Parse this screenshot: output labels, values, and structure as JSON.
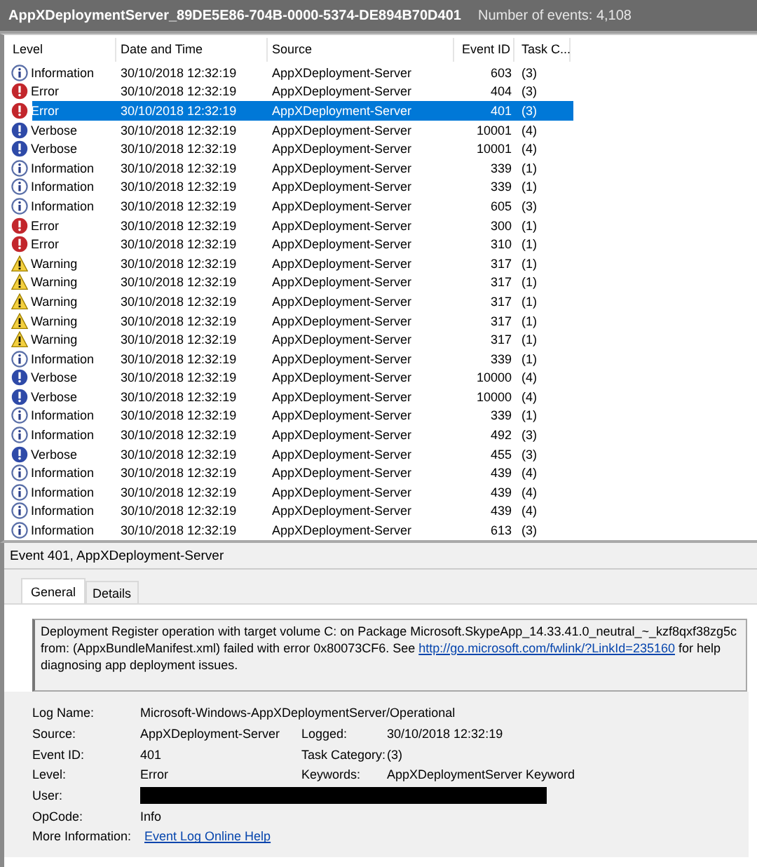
{
  "window": {
    "title": "AppXDeploymentServer_89DE5E86-704B-0000-5374-DE894B70D401",
    "event_count": "Number of events: 4,108"
  },
  "table": {
    "columns": [
      "Level",
      "Date and Time",
      "Source",
      "Event ID",
      "Task C..."
    ],
    "rows": [
      {
        "level": "Information",
        "kind": "info",
        "date": "30/10/2018 12:32:19",
        "source": "AppXDeployment-Server",
        "event_id": "603",
        "task": "(3)",
        "selected": false
      },
      {
        "level": "Error",
        "kind": "error",
        "date": "30/10/2018 12:32:19",
        "source": "AppXDeployment-Server",
        "event_id": "404",
        "task": "(3)",
        "selected": false
      },
      {
        "level": "Error",
        "kind": "error",
        "date": "30/10/2018 12:32:19",
        "source": "AppXDeployment-Server",
        "event_id": "401",
        "task": "(3)",
        "selected": true
      },
      {
        "level": "Verbose",
        "kind": "verbose",
        "date": "30/10/2018 12:32:19",
        "source": "AppXDeployment-Server",
        "event_id": "10001",
        "task": "(4)",
        "selected": false
      },
      {
        "level": "Verbose",
        "kind": "verbose",
        "date": "30/10/2018 12:32:19",
        "source": "AppXDeployment-Server",
        "event_id": "10001",
        "task": "(4)",
        "selected": false
      },
      {
        "level": "Information",
        "kind": "info",
        "date": "30/10/2018 12:32:19",
        "source": "AppXDeployment-Server",
        "event_id": "339",
        "task": "(1)",
        "selected": false
      },
      {
        "level": "Information",
        "kind": "info",
        "date": "30/10/2018 12:32:19",
        "source": "AppXDeployment-Server",
        "event_id": "339",
        "task": "(1)",
        "selected": false
      },
      {
        "level": "Information",
        "kind": "info",
        "date": "30/10/2018 12:32:19",
        "source": "AppXDeployment-Server",
        "event_id": "605",
        "task": "(3)",
        "selected": false
      },
      {
        "level": "Error",
        "kind": "error",
        "date": "30/10/2018 12:32:19",
        "source": "AppXDeployment-Server",
        "event_id": "300",
        "task": "(1)",
        "selected": false
      },
      {
        "level": "Error",
        "kind": "error",
        "date": "30/10/2018 12:32:19",
        "source": "AppXDeployment-Server",
        "event_id": "310",
        "task": "(1)",
        "selected": false
      },
      {
        "level": "Warning",
        "kind": "warning",
        "date": "30/10/2018 12:32:19",
        "source": "AppXDeployment-Server",
        "event_id": "317",
        "task": "(1)",
        "selected": false
      },
      {
        "level": "Warning",
        "kind": "warning",
        "date": "30/10/2018 12:32:19",
        "source": "AppXDeployment-Server",
        "event_id": "317",
        "task": "(1)",
        "selected": false
      },
      {
        "level": "Warning",
        "kind": "warning",
        "date": "30/10/2018 12:32:19",
        "source": "AppXDeployment-Server",
        "event_id": "317",
        "task": "(1)",
        "selected": false
      },
      {
        "level": "Warning",
        "kind": "warning",
        "date": "30/10/2018 12:32:19",
        "source": "AppXDeployment-Server",
        "event_id": "317",
        "task": "(1)",
        "selected": false
      },
      {
        "level": "Warning",
        "kind": "warning",
        "date": "30/10/2018 12:32:19",
        "source": "AppXDeployment-Server",
        "event_id": "317",
        "task": "(1)",
        "selected": false
      },
      {
        "level": "Information",
        "kind": "info",
        "date": "30/10/2018 12:32:19",
        "source": "AppXDeployment-Server",
        "event_id": "339",
        "task": "(1)",
        "selected": false
      },
      {
        "level": "Verbose",
        "kind": "verbose",
        "date": "30/10/2018 12:32:19",
        "source": "AppXDeployment-Server",
        "event_id": "10000",
        "task": "(4)",
        "selected": false
      },
      {
        "level": "Verbose",
        "kind": "verbose",
        "date": "30/10/2018 12:32:19",
        "source": "AppXDeployment-Server",
        "event_id": "10000",
        "task": "(4)",
        "selected": false
      },
      {
        "level": "Information",
        "kind": "info",
        "date": "30/10/2018 12:32:19",
        "source": "AppXDeployment-Server",
        "event_id": "339",
        "task": "(1)",
        "selected": false
      },
      {
        "level": "Information",
        "kind": "info",
        "date": "30/10/2018 12:32:19",
        "source": "AppXDeployment-Server",
        "event_id": "492",
        "task": "(3)",
        "selected": false
      },
      {
        "level": "Verbose",
        "kind": "verbose",
        "date": "30/10/2018 12:32:19",
        "source": "AppXDeployment-Server",
        "event_id": "455",
        "task": "(3)",
        "selected": false
      },
      {
        "level": "Information",
        "kind": "info",
        "date": "30/10/2018 12:32:19",
        "source": "AppXDeployment-Server",
        "event_id": "439",
        "task": "(4)",
        "selected": false
      },
      {
        "level": "Information",
        "kind": "info",
        "date": "30/10/2018 12:32:19",
        "source": "AppXDeployment-Server",
        "event_id": "439",
        "task": "(4)",
        "selected": false
      },
      {
        "level": "Information",
        "kind": "info",
        "date": "30/10/2018 12:32:19",
        "source": "AppXDeployment-Server",
        "event_id": "439",
        "task": "(4)",
        "selected": false
      },
      {
        "level": "Information",
        "kind": "info",
        "date": "30/10/2018 12:32:19",
        "source": "AppXDeployment-Server",
        "event_id": "613",
        "task": "(3)",
        "selected": false
      }
    ]
  },
  "details": {
    "title": "Event 401, AppXDeployment-Server",
    "tabs": [
      {
        "label": "General",
        "selected": true
      },
      {
        "label": "Details",
        "selected": false
      }
    ],
    "message": {
      "before": "Deployment Register operation with target volume C: on Package Microsoft.SkypeApp_14.33.41.0_neutral_~_kzf8qxf38zg5c from: (AppxBundleManifest.xml)  failed with error 0x80073CF6. See",
      "link": "http://go.microsoft.com/fwlink/?LinkId=235160",
      "after": "for help diagnosing app deployment issues."
    },
    "fields": [
      {
        "label": "Log Name:",
        "value": "Microsoft-Windows-AppXDeploymentServer/Operational",
        "kind": "text"
      },
      {
        "label": "Source:",
        "value": "AppXDeployment-Server",
        "kind": "text",
        "label2": "Logged:",
        "value2": "30/10/2018 12:32:19"
      },
      {
        "label": "Event ID:",
        "value": "401",
        "kind": "text",
        "label2": "Task Category:",
        "value2": "(3)"
      },
      {
        "label": "Level:",
        "value": "Error",
        "kind": "text",
        "label2": "Keywords:",
        "value2": "AppXDeploymentServer Keyword"
      },
      {
        "label": "User:",
        "kind": "redacted"
      },
      {
        "label": "OpCode:",
        "value": "Info",
        "kind": "text"
      },
      {
        "label": "More Information:",
        "value": "Event Log Online Help",
        "kind": "link"
      }
    ]
  }
}
